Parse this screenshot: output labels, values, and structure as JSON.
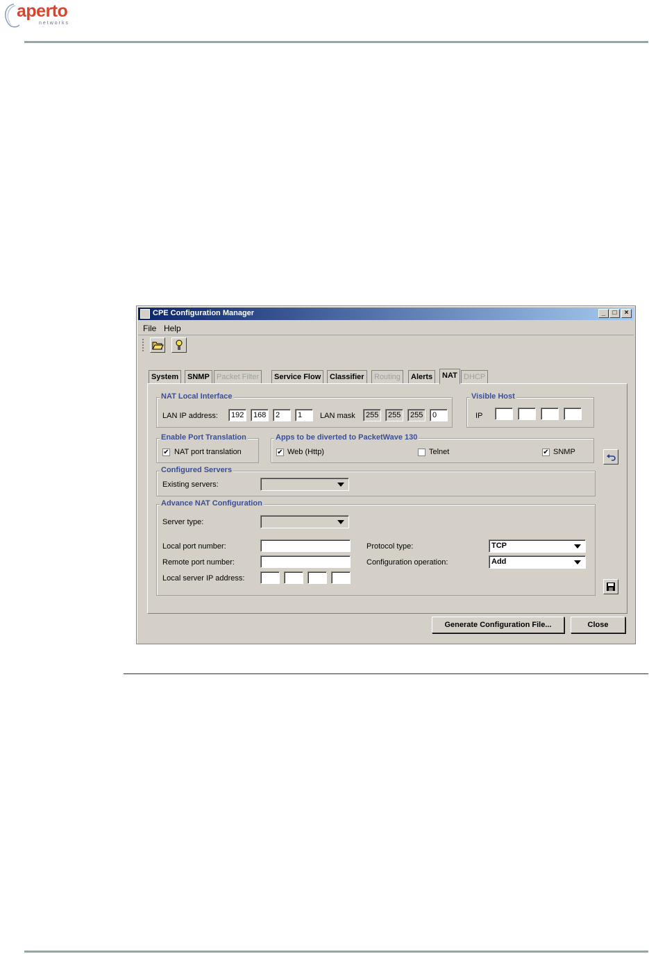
{
  "brand": {
    "logo_text": "aperto",
    "logo_subtext": "networks"
  },
  "window": {
    "title": "CPE Configuration Manager",
    "controls": {
      "minimize": "_",
      "maximize": "□",
      "close": "×"
    }
  },
  "menu": [
    "File",
    "Help"
  ],
  "toolbar": {
    "buttons": [
      {
        "icon": "open-folder-icon"
      },
      {
        "icon": "wizard-icon"
      }
    ]
  },
  "tabs": [
    {
      "label": "System",
      "state": "enabled"
    },
    {
      "label": "SNMP",
      "state": "enabled"
    },
    {
      "label": "Packet Filter",
      "state": "disabled"
    },
    {
      "label": "Service Flow",
      "state": "enabled"
    },
    {
      "label": "Classifier",
      "state": "enabled"
    },
    {
      "label": "Routing",
      "state": "disabled"
    },
    {
      "label": "Alerts",
      "state": "enabled"
    },
    {
      "label": "NAT",
      "state": "active"
    },
    {
      "label": "DHCP",
      "state": "disabled"
    }
  ],
  "nat_local_interface": {
    "title": "NAT Local Interface",
    "lan_ip_label": "LAN IP address:",
    "lan_ip": [
      "192",
      "168",
      "2",
      "1"
    ],
    "lan_mask_label": "LAN mask",
    "lan_mask": [
      "255",
      "255",
      "255",
      "0"
    ]
  },
  "visible_host": {
    "title": "Visible Host",
    "ip_label": "IP",
    "ip": [
      "",
      "",
      "",
      ""
    ]
  },
  "enable_port_translation": {
    "title": "Enable Port Translation",
    "checkbox_label": "NAT port translation",
    "checked": true
  },
  "apps_diverted": {
    "title": "Apps to be diverted to PacketWave 130",
    "web_label": "Web (Http)",
    "web_checked": true,
    "telnet_label": "Telnet",
    "telnet_checked": false,
    "snmp_label": "SNMP",
    "snmp_checked": true
  },
  "configured_servers": {
    "title": "Configured Servers",
    "existing_label": "Existing servers:",
    "existing_value": ""
  },
  "advance_nat": {
    "title": "Advance NAT Configuration",
    "server_type_label": "Server type:",
    "server_type_value": "",
    "local_port_label": "Local port number:",
    "local_port_value": "",
    "remote_port_label": "Remote port number:",
    "remote_port_value": "",
    "local_server_ip_label": "Local server IP address:",
    "local_server_ip": [
      "",
      "",
      "",
      ""
    ],
    "protocol_label": "Protocol type:",
    "protocol_value": "TCP",
    "operation_label": "Configuration operation:",
    "operation_value": "Add"
  },
  "buttons": {
    "generate": "Generate Configuration File...",
    "close": "Close"
  }
}
